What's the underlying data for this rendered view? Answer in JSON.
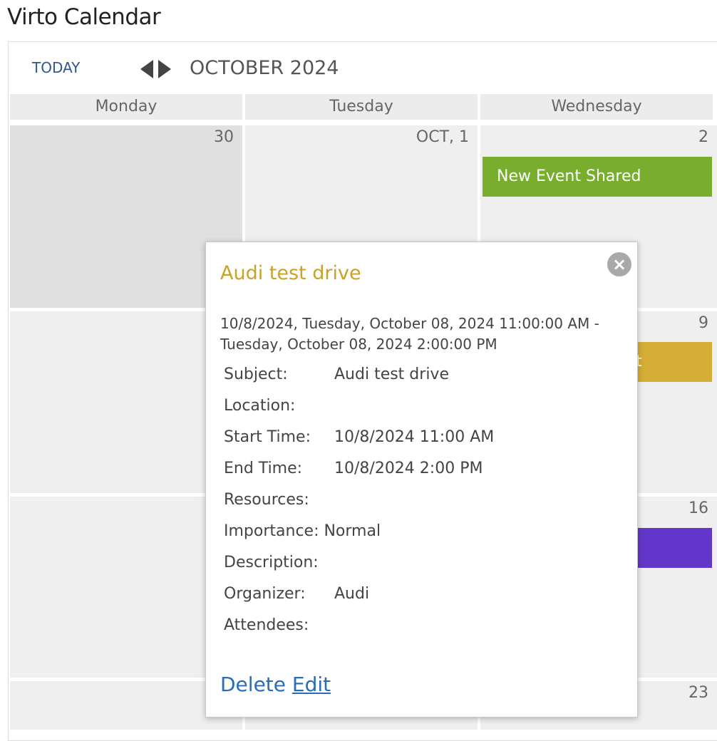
{
  "app": {
    "title": "Virto Calendar"
  },
  "toolbar": {
    "today_label": "TODAY",
    "month_label": "OCTOBER 2024",
    "prev_icon": "triangle-left-icon",
    "next_icon": "triangle-right-icon"
  },
  "day_headers": [
    "Monday",
    "Tuesday",
    "Wednesday"
  ],
  "weeks": [
    {
      "days": [
        "30",
        "OCT, 1",
        "2"
      ]
    },
    {
      "days": [
        "",
        "",
        "9"
      ]
    },
    {
      "days": [
        "",
        "",
        "16"
      ]
    },
    {
      "days": [
        "",
        "",
        "23"
      ]
    }
  ],
  "events": [
    {
      "title": "New Event Shared",
      "color": "#78ad2e"
    },
    {
      "title": "t",
      "color": "#d4ae36"
    },
    {
      "title": "",
      "color": "#6236c9"
    }
  ],
  "popup": {
    "title": "Audi test drive",
    "title_color": "#c9a227",
    "when_text": "10/8/2024, Tuesday, October 08, 2024 11:00:00 AM - Tuesday, October 08, 2024 2:00:00 PM",
    "close_icon": "close-icon",
    "fields": [
      {
        "label": "Subject:",
        "value": "Audi test drive"
      },
      {
        "label": "Location:",
        "value": ""
      },
      {
        "label": "Start Time:",
        "value": "10/8/2024 11:00 AM"
      },
      {
        "label": "End Time:",
        "value": "10/8/2024 2:00 PM"
      },
      {
        "label": "Resources:",
        "value": ""
      },
      {
        "label": "Importance: Normal",
        "value": ""
      },
      {
        "label": "Description:",
        "value": ""
      },
      {
        "label": "Organizer:",
        "value": "Audi"
      },
      {
        "label": "Attendees:",
        "value": ""
      }
    ],
    "delete_label": "Delete",
    "edit_label": "Edit"
  }
}
